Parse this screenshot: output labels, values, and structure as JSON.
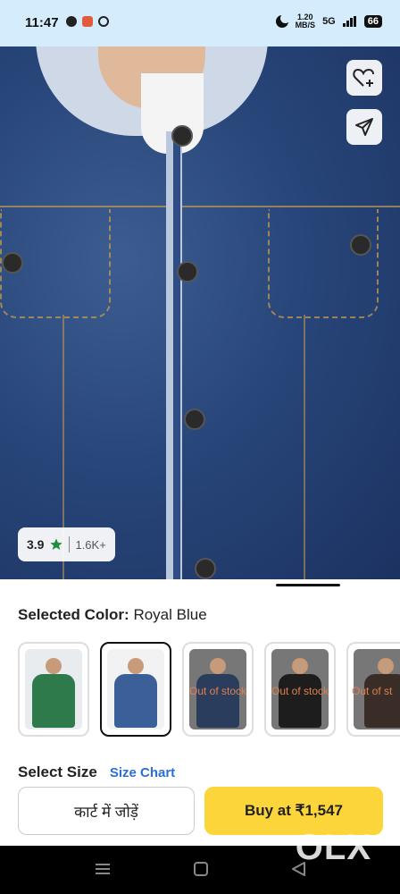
{
  "status": {
    "time": "11:47",
    "speed_top": "1.20",
    "speed_bottom": "MB/S",
    "network": "5G",
    "battery": "66"
  },
  "product": {
    "rating": "3.9",
    "rating_count": "1.6K+"
  },
  "color": {
    "label": "Selected Color:",
    "value": "Royal Blue",
    "thumbnails": [
      {
        "name": "green",
        "out_of_stock": "",
        "color": "#2e7a4a"
      },
      {
        "name": "royal-blue",
        "out_of_stock": "",
        "color": "#3b5f98"
      },
      {
        "name": "navy",
        "out_of_stock": "Out of stock",
        "color": "#2a3d5c"
      },
      {
        "name": "black",
        "out_of_stock": "Out of stock",
        "color": "#1d1d1d"
      },
      {
        "name": "brown",
        "out_of_stock": "Out of st",
        "color": "#3a2c26"
      }
    ]
  },
  "size": {
    "title": "Select Size",
    "chart_link": "Size Chart"
  },
  "actions": {
    "add_to_cart": "कार्ट में जोड़ें",
    "buy_now": "Buy at ₹1,547"
  },
  "watermark": "OLX",
  "colors": {
    "accent": "#fcd53b",
    "link": "#2a6fd6",
    "rating_star": "#1e8f3e",
    "out_of_stock": "#e08050"
  }
}
